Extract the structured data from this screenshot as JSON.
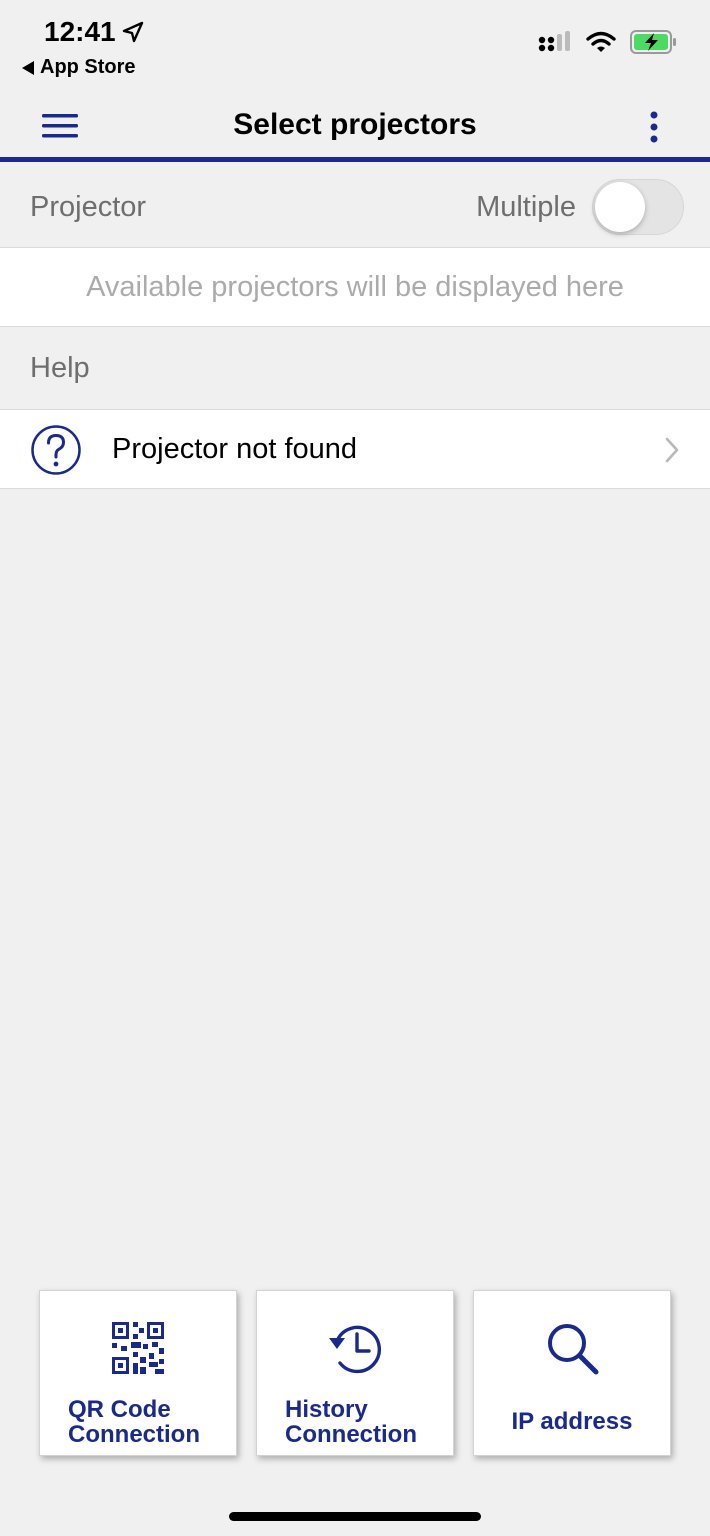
{
  "status_bar": {
    "time": "12:41",
    "back_label": "App Store"
  },
  "nav": {
    "title": "Select projectors",
    "menu_icon": "hamburger-menu-icon",
    "more_icon": "vertical-ellipsis-icon"
  },
  "projector_section": {
    "header": "Projector",
    "multiple_label": "Multiple",
    "multiple_enabled": false,
    "empty_text": "Available projectors will be displayed here"
  },
  "help_section": {
    "header": "Help",
    "items": [
      {
        "label": "Projector not found",
        "icon": "question-circle-icon"
      }
    ]
  },
  "bottom_actions": [
    {
      "label": "QR Code Connection",
      "line1": "QR Code",
      "line2": "Connection",
      "icon": "qr-code-icon"
    },
    {
      "label": "History Connection",
      "line1": "History",
      "line2": "Connection",
      "icon": "history-icon"
    },
    {
      "label": "IP address",
      "line1": "IP address",
      "line2": "",
      "icon": "search-icon"
    }
  ],
  "colors": {
    "accent": "#1a2a8c",
    "background": "#f0f0f0",
    "battery": "#4cd964"
  }
}
